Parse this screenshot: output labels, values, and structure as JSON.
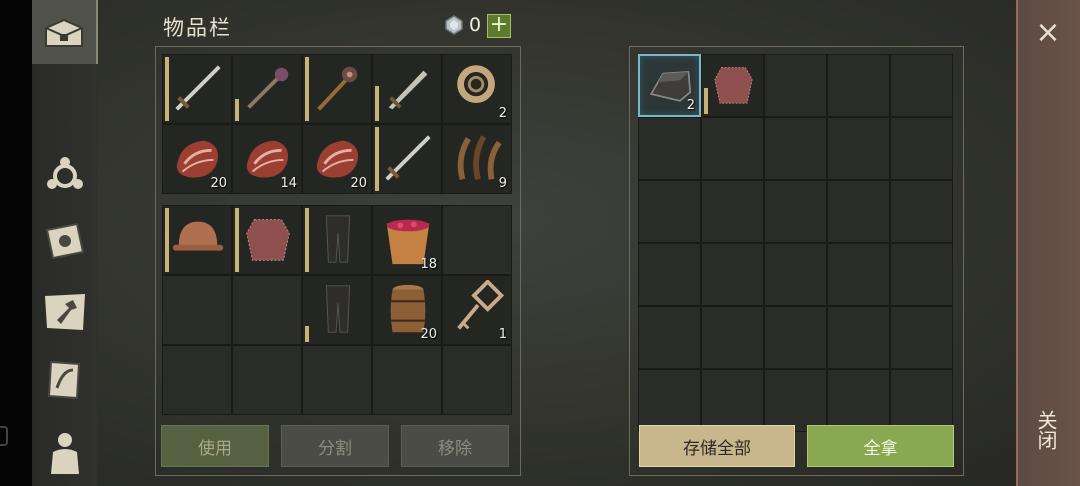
{
  "header": {
    "title": "物品栏",
    "gem_count": "0",
    "plus_label": "+"
  },
  "sidebar": {
    "tabs": [
      {
        "name": "chest-icon",
        "active": true
      },
      {
        "name": "skills-icon"
      },
      {
        "name": "sun-book-icon"
      },
      {
        "name": "craft-hammer-icon"
      },
      {
        "name": "quest-scroll-icon"
      },
      {
        "name": "character-icon"
      }
    ]
  },
  "inventory": {
    "rows": [
      [
        {
          "item": "sword",
          "dur": 1
        },
        {
          "item": "mace",
          "dur": 0.35
        },
        {
          "item": "morningstar",
          "dur": 1
        },
        {
          "item": "broadsword",
          "dur": 0.55
        },
        {
          "item": "rope",
          "count": "2"
        }
      ],
      [
        {
          "item": "meat",
          "count": "20"
        },
        {
          "item": "meat",
          "count": "14"
        },
        {
          "item": "meat",
          "count": "20"
        },
        {
          "item": "sword",
          "dur": 1
        },
        {
          "item": "fiber",
          "count": "9"
        }
      ],
      [
        {
          "item": "helmet",
          "dur": 1
        },
        {
          "item": "chainmail",
          "dur": 1
        },
        {
          "item": "pants",
          "dur": 1
        },
        {
          "item": "berry-bucket",
          "count": "18"
        },
        {
          "item": ""
        }
      ],
      [
        {
          "item": ""
        },
        {
          "item": ""
        },
        {
          "item": "pants",
          "dur": 0.25
        },
        {
          "item": "barrel",
          "count": "20"
        },
        {
          "item": "key",
          "count": "1"
        }
      ],
      [
        {
          "item": ""
        },
        {
          "item": ""
        },
        {
          "item": ""
        },
        {
          "item": ""
        },
        {
          "item": ""
        }
      ]
    ],
    "buttons": {
      "use": "使用",
      "split": "分割",
      "remove": "移除"
    }
  },
  "storage": {
    "cells": [
      {
        "item": "iron-ingot",
        "count": "2",
        "selected": true
      },
      {
        "item": "chainmail",
        "dur": 0.45
      }
    ],
    "buttons": {
      "store_all": "存储全部",
      "take_all": "全拿"
    }
  },
  "close": {
    "x": "×",
    "label": "关闭"
  }
}
